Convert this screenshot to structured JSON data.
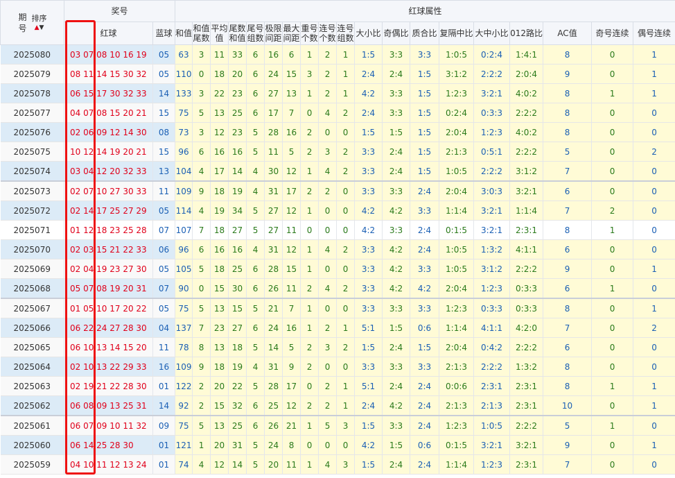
{
  "header": {
    "period": "期号",
    "sort": "排序",
    "prize": "奖号",
    "red_ball": "红球",
    "blue_ball": "蓝球",
    "red_attr": "红球属性",
    "cols": [
      "和值",
      "和值尾数",
      "平均值",
      "尾数和值",
      "尾号组数",
      "极限间距",
      "最大间距",
      "重号个数",
      "连号个数",
      "连号组数",
      "大小比",
      "奇偶比",
      "质合比",
      "复隔中比",
      "大中小比",
      "012路比",
      "AC值",
      "奇号连续",
      "偶号连续"
    ]
  },
  "rows": [
    {
      "p": "2025080",
      "red": "03 07 08 10 16 19",
      "blue": "05",
      "v": [
        "63",
        "3",
        "11",
        "33",
        "6",
        "16",
        "6",
        "1",
        "2",
        "1",
        "1:5",
        "3:3",
        "3:3",
        "1:0:5",
        "0:2:4",
        "1:4:1",
        "8",
        "0",
        "1"
      ]
    },
    {
      "p": "2025079",
      "red": "08 11 14 15 30 32",
      "blue": "05",
      "v": [
        "110",
        "0",
        "18",
        "20",
        "6",
        "24",
        "15",
        "3",
        "2",
        "1",
        "2:4",
        "2:4",
        "1:5",
        "3:1:2",
        "2:2:2",
        "2:0:4",
        "9",
        "0",
        "1"
      ]
    },
    {
      "p": "2025078",
      "red": "06 15 17 30 32 33",
      "blue": "14",
      "v": [
        "133",
        "3",
        "22",
        "23",
        "6",
        "27",
        "13",
        "1",
        "2",
        "1",
        "4:2",
        "3:3",
        "1:5",
        "1:2:3",
        "3:2:1",
        "4:0:2",
        "8",
        "1",
        "1"
      ]
    },
    {
      "p": "2025077",
      "red": "04 07 08 15 20 21",
      "blue": "15",
      "v": [
        "75",
        "5",
        "13",
        "25",
        "6",
        "17",
        "7",
        "0",
        "4",
        "2",
        "2:4",
        "3:3",
        "1:5",
        "0:2:4",
        "0:3:3",
        "2:2:2",
        "8",
        "0",
        "0"
      ]
    },
    {
      "p": "2025076",
      "red": "02 06 09 12 14 30",
      "blue": "08",
      "v": [
        "73",
        "3",
        "12",
        "23",
        "5",
        "28",
        "16",
        "2",
        "0",
        "0",
        "1:5",
        "1:5",
        "1:5",
        "2:0:4",
        "1:2:3",
        "4:0:2",
        "8",
        "0",
        "0"
      ]
    },
    {
      "p": "2025075",
      "red": "10 12 14 19 20 21",
      "blue": "15",
      "v": [
        "96",
        "6",
        "16",
        "16",
        "5",
        "11",
        "5",
        "2",
        "3",
        "2",
        "3:3",
        "2:4",
        "1:5",
        "2:1:3",
        "0:5:1",
        "2:2:2",
        "5",
        "0",
        "2"
      ]
    },
    {
      "p": "2025074",
      "red": "03 04 12 20 32 33",
      "blue": "13",
      "v": [
        "104",
        "4",
        "17",
        "14",
        "4",
        "30",
        "12",
        "1",
        "4",
        "2",
        "3:3",
        "2:4",
        "1:5",
        "1:0:5",
        "2:2:2",
        "3:1:2",
        "7",
        "0",
        "0"
      ]
    },
    {
      "p": "2025073",
      "red": "02 07 10 27 30 33",
      "blue": "11",
      "v": [
        "109",
        "9",
        "18",
        "19",
        "4",
        "31",
        "17",
        "2",
        "2",
        "0",
        "3:3",
        "3:3",
        "2:4",
        "2:0:4",
        "3:0:3",
        "3:2:1",
        "6",
        "0",
        "0"
      ]
    },
    {
      "p": "2025072",
      "red": "02 14 17 25 27 29",
      "blue": "05",
      "v": [
        "114",
        "4",
        "19",
        "34",
        "5",
        "27",
        "12",
        "1",
        "0",
        "0",
        "4:2",
        "4:2",
        "3:3",
        "1:1:4",
        "3:2:1",
        "1:1:4",
        "7",
        "2",
        "0"
      ]
    },
    {
      "p": "2025071",
      "red": "01 12 18 23 25 28",
      "blue": "07",
      "v": [
        "107",
        "7",
        "18",
        "27",
        "5",
        "27",
        "11",
        "0",
        "0",
        "0",
        "4:2",
        "3:3",
        "2:4",
        "0:1:5",
        "3:2:1",
        "2:3:1",
        "8",
        "1",
        "0"
      ]
    },
    {
      "p": "2025070",
      "red": "02 03 15 21 22 33",
      "blue": "06",
      "v": [
        "96",
        "6",
        "16",
        "16",
        "4",
        "31",
        "12",
        "1",
        "4",
        "2",
        "3:3",
        "4:2",
        "2:4",
        "1:0:5",
        "1:3:2",
        "4:1:1",
        "6",
        "0",
        "0"
      ]
    },
    {
      "p": "2025069",
      "red": "02 04 19 23 27 30",
      "blue": "05",
      "v": [
        "105",
        "5",
        "18",
        "25",
        "6",
        "28",
        "15",
        "1",
        "0",
        "0",
        "3:3",
        "4:2",
        "3:3",
        "1:0:5",
        "3:1:2",
        "2:2:2",
        "9",
        "0",
        "1"
      ]
    },
    {
      "p": "2025068",
      "red": "05 07 08 19 20 31",
      "blue": "07",
      "v": [
        "90",
        "0",
        "15",
        "30",
        "6",
        "26",
        "11",
        "2",
        "4",
        "2",
        "3:3",
        "4:2",
        "4:2",
        "2:0:4",
        "1:2:3",
        "0:3:3",
        "6",
        "1",
        "0"
      ]
    },
    {
      "p": "2025067",
      "red": "01 05 10 17 20 22",
      "blue": "05",
      "v": [
        "75",
        "5",
        "13",
        "15",
        "5",
        "21",
        "7",
        "1",
        "0",
        "0",
        "3:3",
        "3:3",
        "3:3",
        "1:2:3",
        "0:3:3",
        "0:3:3",
        "8",
        "0",
        "1"
      ]
    },
    {
      "p": "2025066",
      "red": "06 22 24 27 28 30",
      "blue": "04",
      "v": [
        "137",
        "7",
        "23",
        "27",
        "6",
        "24",
        "16",
        "1",
        "2",
        "1",
        "5:1",
        "1:5",
        "0:6",
        "1:1:4",
        "4:1:1",
        "4:2:0",
        "7",
        "0",
        "2"
      ]
    },
    {
      "p": "2025065",
      "red": "06 10 13 14 15 20",
      "blue": "11",
      "v": [
        "78",
        "8",
        "13",
        "18",
        "5",
        "14",
        "5",
        "2",
        "3",
        "2",
        "1:5",
        "2:4",
        "1:5",
        "2:0:4",
        "0:4:2",
        "2:2:2",
        "6",
        "0",
        "0"
      ]
    },
    {
      "p": "2025064",
      "red": "02 10 13 22 29 33",
      "blue": "16",
      "v": [
        "109",
        "9",
        "18",
        "19",
        "4",
        "31",
        "9",
        "2",
        "0",
        "0",
        "3:3",
        "3:3",
        "3:3",
        "2:1:3",
        "2:2:2",
        "1:3:2",
        "8",
        "0",
        "0"
      ]
    },
    {
      "p": "2025063",
      "red": "02 19 21 22 28 30",
      "blue": "01",
      "v": [
        "122",
        "2",
        "20",
        "22",
        "5",
        "28",
        "17",
        "0",
        "2",
        "1",
        "5:1",
        "2:4",
        "2:4",
        "0:0:6",
        "2:3:1",
        "2:3:1",
        "8",
        "1",
        "1"
      ]
    },
    {
      "p": "2025062",
      "red": "06 08 09 13 25 31",
      "blue": "14",
      "v": [
        "92",
        "2",
        "15",
        "32",
        "6",
        "25",
        "12",
        "2",
        "2",
        "1",
        "2:4",
        "4:2",
        "2:4",
        "2:1:3",
        "2:1:3",
        "2:3:1",
        "10",
        "0",
        "1"
      ]
    },
    {
      "p": "2025061",
      "red": "06 07 09 10 11 32",
      "blue": "09",
      "v": [
        "75",
        "5",
        "13",
        "25",
        "6",
        "26",
        "21",
        "1",
        "5",
        "3",
        "1:5",
        "3:3",
        "2:4",
        "1:2:3",
        "1:0:5",
        "2:2:2",
        "5",
        "1",
        "0"
      ]
    },
    {
      "p": "2025060",
      "red": "06 14 25 28 30",
      "blue": "01",
      "v": [
        "121",
        "1",
        "20",
        "31",
        "5",
        "24",
        "8",
        "0",
        "0",
        "0",
        "4:2",
        "1:5",
        "0:6",
        "0:1:5",
        "3:2:1",
        "3:2:1",
        "9",
        "0",
        "1"
      ]
    },
    {
      "p": "2025059",
      "red": "04 10 11 12 13 24",
      "blue": "01",
      "v": [
        "74",
        "4",
        "12",
        "14",
        "5",
        "20",
        "11",
        "1",
        "4",
        "3",
        "1:5",
        "2:4",
        "2:4",
        "1:1:4",
        "1:2:3",
        "2:3:1",
        "7",
        "0",
        "0"
      ]
    }
  ]
}
